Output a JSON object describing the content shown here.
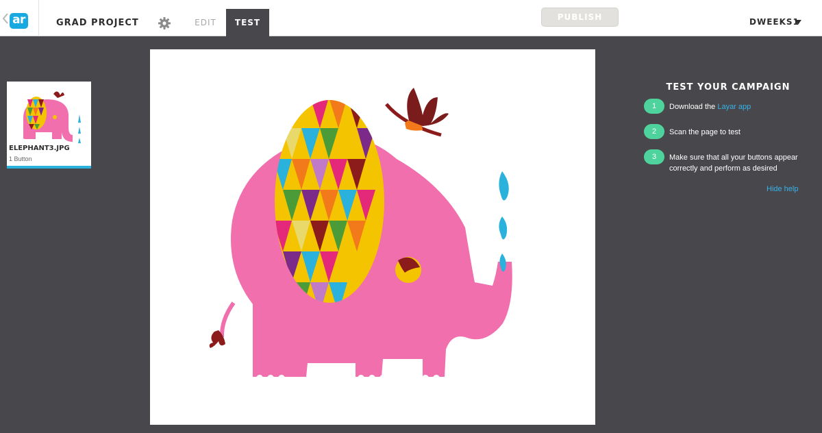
{
  "header": {
    "logo_text": "ar",
    "project_name": "GRAD PROJECT",
    "tabs": [
      {
        "label": "EDIT",
        "active": false
      },
      {
        "label": "TEST",
        "active": true
      }
    ],
    "publish_label": "PUBLISH",
    "user_name": "DWEEKS1"
  },
  "pages": [
    {
      "name": "ELEPHANT3.JPG",
      "subtitle": "1 Button",
      "selected": true
    }
  ],
  "help": {
    "title": "TEST YOUR CAMPAIGN",
    "steps": [
      {
        "number": "1",
        "text_before": "Download the ",
        "link": "Layar app",
        "text_after": ""
      },
      {
        "number": "2",
        "text_before": "Scan the page to test",
        "link": "",
        "text_after": ""
      },
      {
        "number": "3",
        "text_before": "Make sure that all your buttons appear correctly and perform as desired",
        "link": "",
        "text_after": ""
      }
    ],
    "hide_label": "Hide help"
  },
  "colors": {
    "accent": "#19a9e1",
    "step_badge": "#4fd39c",
    "link": "#35b3ea",
    "workspace": "#48484c",
    "elephant_pink": "#f16fac"
  },
  "icons": [
    "back-chevron-icon",
    "settings-gear-icon",
    "dropdown-caret-icon"
  ]
}
